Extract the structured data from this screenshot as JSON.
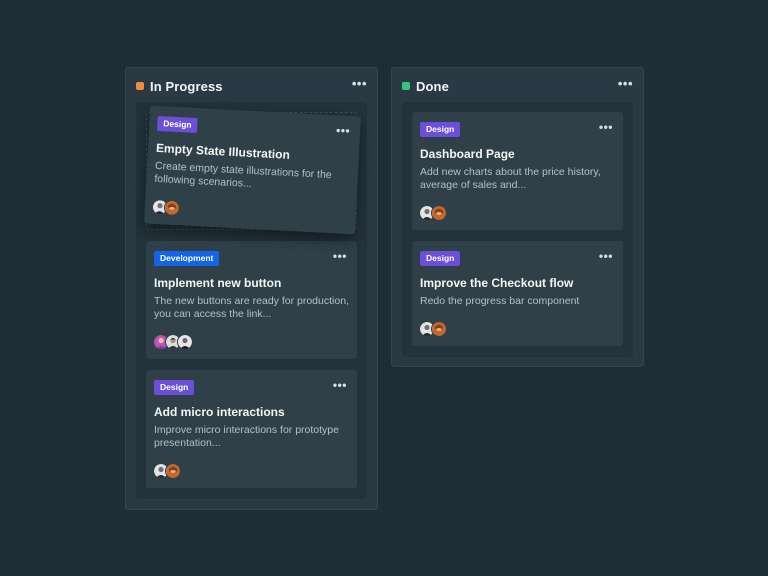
{
  "columns": {
    "in_progress": {
      "title": "In Progress",
      "dot_color": "#f08a3c",
      "more_label": "•••"
    },
    "done": {
      "title": "Done",
      "dot_color": "#33c77a",
      "more_label": "•••"
    }
  },
  "colors": {
    "tag_design": "#6b4fd8",
    "tag_development": "#1664e6"
  },
  "cards": {
    "empty_state": {
      "tag": "Design",
      "title": "Empty State Illustration",
      "description": "Create empty state illustrations for the following scenarios...",
      "more_label": "•••"
    },
    "new_button": {
      "tag": "Development",
      "title": "Implement new button",
      "description": "The new buttons are ready for production, you can access the link...",
      "more_label": "•••"
    },
    "micro_interactions": {
      "tag": "Design",
      "title": "Add micro interactions",
      "description": "Improve micro interactions for prototype presentation...",
      "more_label": "•••"
    },
    "dashboard_page": {
      "tag": "Design",
      "title": "Dashboard Page",
      "description": "Add new charts about the price history, average of sales and...",
      "more_label": "•••"
    },
    "checkout_flow": {
      "tag": "Design",
      "title": "Improve the Checkout flow",
      "description": "Redo the progress bar component",
      "more_label": "•••"
    }
  }
}
